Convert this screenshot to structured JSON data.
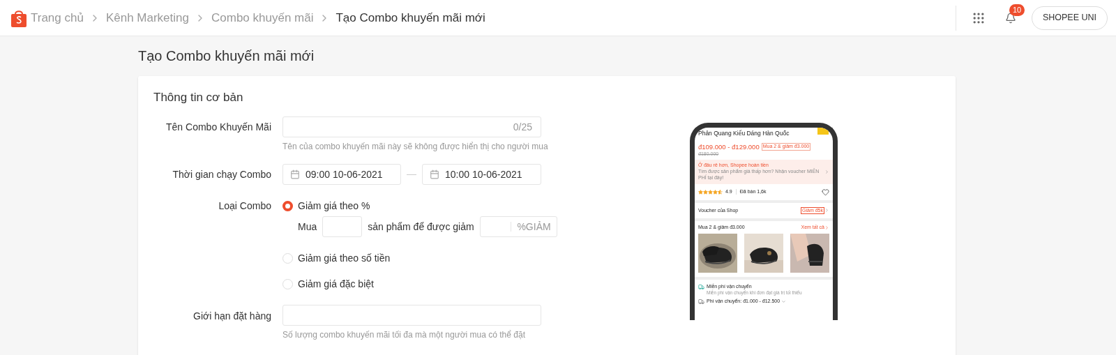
{
  "header": {
    "breadcrumbs": [
      {
        "label": "Trang chủ",
        "current": false
      },
      {
        "label": "Kênh Marketing",
        "current": false
      },
      {
        "label": "Combo khuyến mãi",
        "current": false
      },
      {
        "label": "Tạo Combo khuyến mãi mới",
        "current": true
      }
    ],
    "notification_count": "10",
    "account_button": "SHOPEE UNI"
  },
  "page_title": "Tạo Combo khuyến mãi mới",
  "form": {
    "section_title": "Thông tin cơ bản",
    "name": {
      "label": "Tên Combo Khuyến Mãi",
      "counter": "0/25",
      "hint": "Tên của combo khuyến mãi này sẽ không được hiển thị cho người mua"
    },
    "period": {
      "label": "Thời gian chạy Combo",
      "start": "09:00 10-06-2021",
      "end": "10:00 10-06-2021"
    },
    "type": {
      "label": "Loại Combo",
      "options": [
        {
          "label": "Giảm giá theo %",
          "selected": true
        },
        {
          "label": "Giảm giá theo số tiền",
          "selected": false
        },
        {
          "label": "Giảm giá đặc biệt",
          "selected": false
        }
      ],
      "buy_label": "Mua",
      "middle_label": "sản phẩm để được giảm",
      "suffix": "%GIẢM"
    },
    "limit": {
      "label": "Giới hạn đặt hàng",
      "hint": "Số lượng combo khuyến mãi tối đa mà một người mua có thể đặt"
    }
  },
  "preview": {
    "product_title": "Phản Quang Kiểu Dáng Hàn Quốc",
    "price_range": "đ109.000 - đ129.000",
    "combo_tag": "Mua 2 & giảm đ3.000",
    "original_price": "đ180.000",
    "cashback_title": "Ở đâu rẻ hơn, Shopee hoàn tiền",
    "cashback_text": "Tìm được sản phẩm giá thấp hơn? Nhận voucher MIỄN PHÍ tại đây!",
    "stars": 4.5,
    "rating": "4.9",
    "sold": "Đã bán 1,6k",
    "voucher_label": "Voucher của Shop",
    "voucher_tag": "Giảm đ5k",
    "combo_title": "Mua 2 & giảm đ3.000",
    "combo_link": "Xem tất cả",
    "shipping_title": "Miễn phí vận chuyển",
    "shipping_text": "Miễn phí vận chuyển khi đơn đạt giá trị tối thiểu",
    "shipping_fee": "Phí vận chuyển: đ1.000 - đ12.500"
  }
}
